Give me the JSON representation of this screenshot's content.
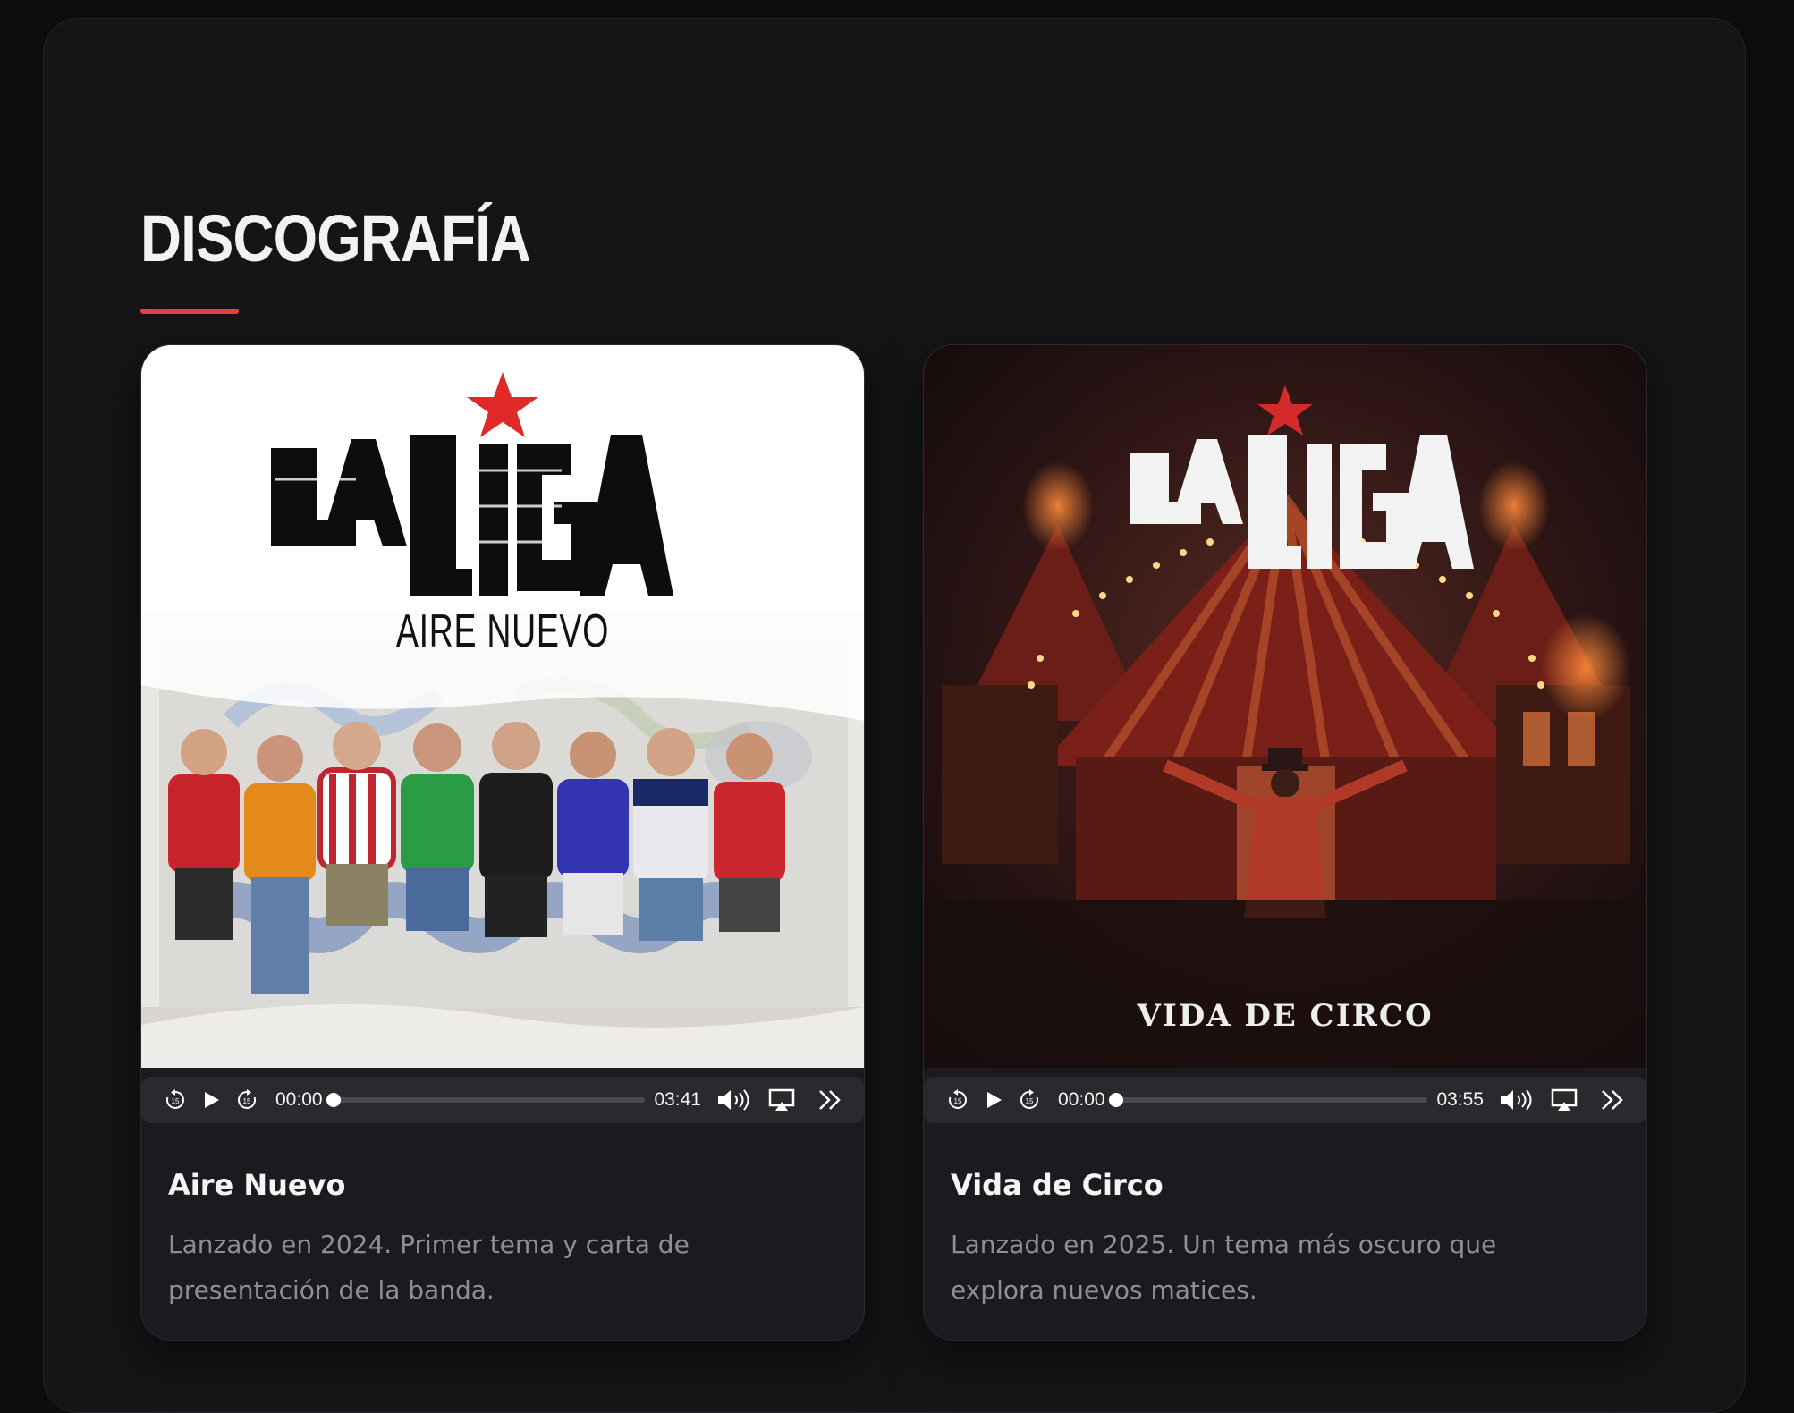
{
  "section": {
    "heading": "DISCOGRAFÍA",
    "accent_color": "#e3413a"
  },
  "albums": [
    {
      "title": "Aire Nuevo",
      "description": "Lanzado en 2024. Primer tema y carta de presentación de la banda.",
      "cover": {
        "logo_text": "LA LIGA",
        "subtitle": "AIRE NUEVO",
        "background": "#ffffff"
      },
      "player": {
        "current_time": "00:00",
        "duration": "03:41",
        "progress": 0
      }
    },
    {
      "title": "Vida de Circo",
      "description": "Lanzado en 2025. Un tema más oscuro que explora nuevos matices.",
      "cover": {
        "logo_text": "LA LIGA",
        "subtitle": "VIDA DE CIRCO",
        "background": "#2a1414"
      },
      "player": {
        "current_time": "00:00",
        "duration": "03:55",
        "progress": 0
      }
    }
  ],
  "icons": {
    "rewind": "rewind-15-icon",
    "play": "play-icon",
    "forward": "forward-15-icon",
    "volume": "volume-icon",
    "airplay": "airplay-icon",
    "more": "chevrons-right-icon"
  }
}
